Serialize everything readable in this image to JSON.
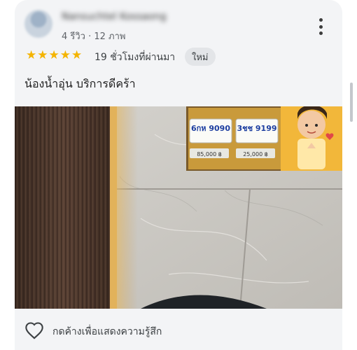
{
  "review": {
    "author_name": "Nansuchtel Kossaong",
    "meta": "4 รีวิว · 12 ภาพ",
    "rating": 5,
    "time_ago": "19 ชั่วโมงที่ผ่านมา",
    "badge": "ใหม่",
    "text": "น้องน้ำอุ่น บริการดีคร้า",
    "photo": {
      "plate_left": "6กห 9090",
      "plate_right": "3ชช 9199",
      "price_left": "85,000 ฿",
      "price_right": "25,000 ฿"
    }
  },
  "actions": {
    "like_label": "กดค้างเพื่อแสดงความรู้สึก"
  },
  "icons": {
    "more": "more-vert-icon",
    "like": "heart-outline-icon",
    "star": "star-icon"
  },
  "colors": {
    "star": "#f4b400",
    "card_bg": "#f3f4f6",
    "badge_bg": "#e3e5e8"
  }
}
